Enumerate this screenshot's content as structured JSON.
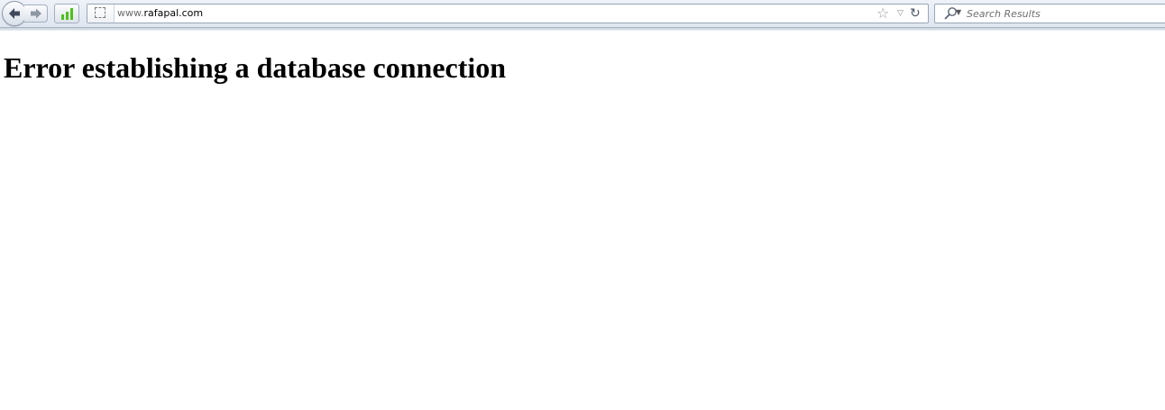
{
  "toolbar": {
    "url_prefix": "www.",
    "url_domain": "rafapal.com",
    "search_placeholder": "Search Results"
  },
  "page": {
    "heading": "Error establishing a database connection"
  },
  "colors": {
    "signal_green": "#4fc01d",
    "toolbar_bg": "#e4eaf2",
    "heading": "#000000"
  },
  "icons": {
    "back": "back-arrow-icon",
    "forward": "forward-arrow-icon",
    "signal": "signal-bars-icon",
    "identity": "site-identity-icon",
    "bookmark": "star-icon",
    "history": "history-dropdown-icon",
    "reload": "reload-icon",
    "search_engine": "magnifier-icon"
  }
}
